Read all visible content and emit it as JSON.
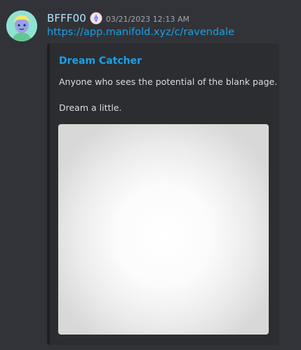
{
  "message": {
    "author": "BFFF00",
    "timestamp": "03/21/2023 12:13 AM",
    "link_text": "https://app.manifold.xyz/c/ravendale",
    "role_icon": "ethereum-diamond-icon",
    "avatar_icon": "cartoon-avatar-icon"
  },
  "embed": {
    "title": "Dream Catcher",
    "description_line1": "Anyone who sees the potential of the blank page.",
    "description_line2": "Dream a little."
  },
  "colors": {
    "background": "#313338",
    "embed_background": "#2b2d31",
    "username": "#b7e3fb",
    "link": "#1ba0e8",
    "text": "#dbdee1",
    "timestamp": "#a2a6ad"
  }
}
